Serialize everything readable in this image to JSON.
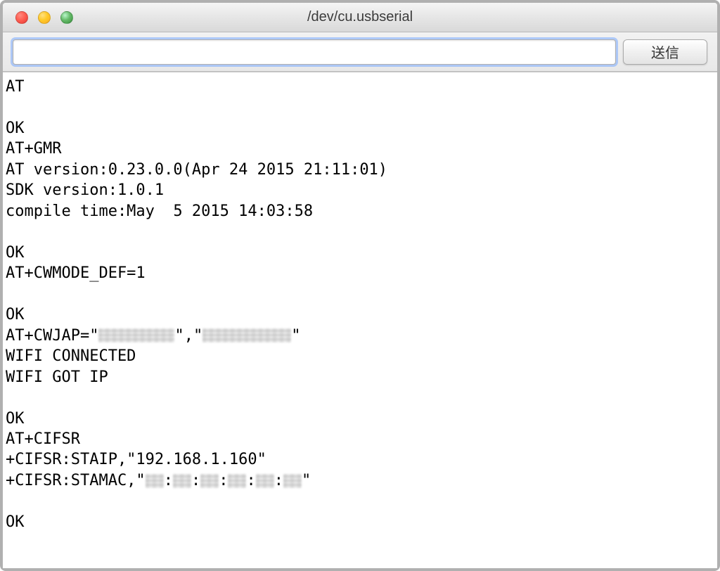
{
  "window": {
    "title": "/dev/cu.usbserial"
  },
  "toolbar": {
    "input_value": "",
    "input_placeholder": "",
    "send_label": "送信"
  },
  "terminal": {
    "lines": [
      {
        "text": "AT"
      },
      {
        "text": ""
      },
      {
        "text": "OK"
      },
      {
        "text": "AT+GMR"
      },
      {
        "text": "AT version:0.23.0.0(Apr 24 2015 21:11:01)"
      },
      {
        "text": "SDK version:1.0.1"
      },
      {
        "text": "compile time:May  5 2015 14:03:58"
      },
      {
        "text": ""
      },
      {
        "text": "OK"
      },
      {
        "text": "AT+CWMODE_DEF=1"
      },
      {
        "text": ""
      },
      {
        "text": "OK"
      },
      {
        "segments": [
          {
            "type": "text",
            "v": "AT+CWJAP=\""
          },
          {
            "type": "redacted",
            "width": 108
          },
          {
            "type": "text",
            "v": "\",\""
          },
          {
            "type": "redacted",
            "width": 126
          },
          {
            "type": "text",
            "v": "\""
          }
        ]
      },
      {
        "text": "WIFI CONNECTED"
      },
      {
        "text": "WIFI GOT IP"
      },
      {
        "text": ""
      },
      {
        "text": "OK"
      },
      {
        "text": "AT+CIFSR"
      },
      {
        "text": "+CIFSR:STAIP,\"192.168.1.160\""
      },
      {
        "segments": [
          {
            "type": "text",
            "v": "+CIFSR:STAMAC,\""
          },
          {
            "type": "redacted",
            "width": 26
          },
          {
            "type": "text",
            "v": ":"
          },
          {
            "type": "redacted",
            "width": 26
          },
          {
            "type": "text",
            "v": ":"
          },
          {
            "type": "redacted",
            "width": 26
          },
          {
            "type": "text",
            "v": ":"
          },
          {
            "type": "redacted",
            "width": 26
          },
          {
            "type": "text",
            "v": ":"
          },
          {
            "type": "redacted",
            "width": 26
          },
          {
            "type": "text",
            "v": ":"
          },
          {
            "type": "redacted",
            "width": 26
          },
          {
            "type": "text",
            "v": "\""
          }
        ]
      },
      {
        "text": ""
      },
      {
        "text": "OK"
      }
    ]
  }
}
